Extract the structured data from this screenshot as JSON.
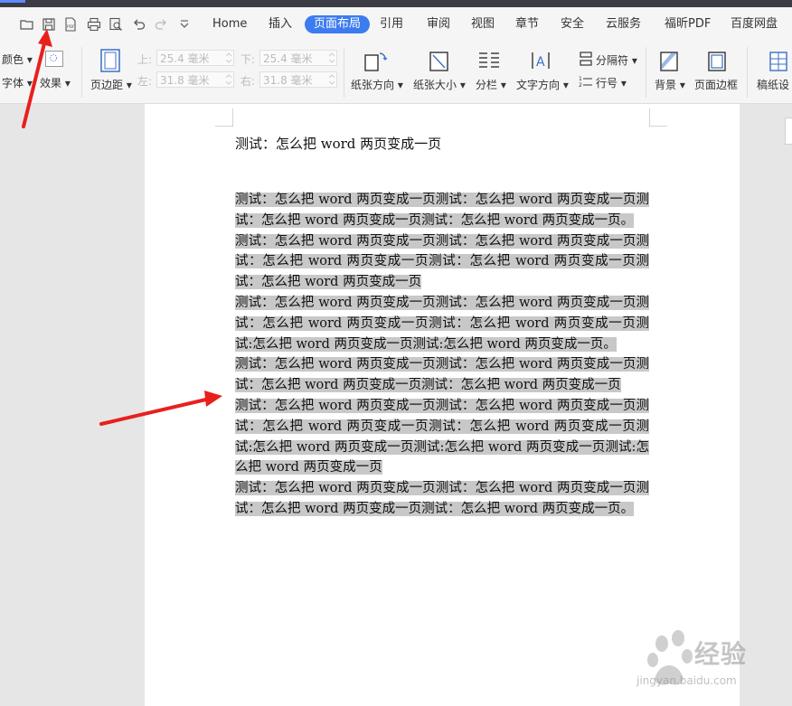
{
  "menubar": {
    "tabs": [
      "Home",
      "插入",
      "页面布局",
      "引用",
      "审阅",
      "视图",
      "章节",
      "安全",
      "云服务",
      "福昕PDF",
      "百度网盘"
    ],
    "active_tab": "页面布局",
    "accent_color": "#3d7cf0"
  },
  "quick_access": [
    "open-icon",
    "save-icon",
    "pdf-icon",
    "print-icon",
    "print-preview-icon",
    "undo-icon",
    "redo-icon",
    "customize-dropdown-icon"
  ],
  "ribbon": {
    "color_label": "颜色",
    "font_label": "字体",
    "effect_label": "效果",
    "margin_label": "页边距",
    "top_label": "上:",
    "top_value": "25.4 毫米",
    "bottom_label": "下:",
    "bottom_value": "25.4 毫米",
    "left_label": "左:",
    "left_value": "31.8 毫米",
    "right_label": "右:",
    "right_value": "31.8 毫米",
    "orientation_label": "纸张方向",
    "paper_size_label": "纸张大小",
    "columns_label": "分栏",
    "text_direction_label": "文字方向",
    "separator_label": "分隔符",
    "line_number_label": "行号",
    "background_label": "背景",
    "page_border_label": "页面边框",
    "draft_label": "稿纸设"
  },
  "document": {
    "title": "测试：怎么把 word 两页变成一页",
    "paragraphs": [
      "测试：怎么把 word 两页变成一页测试：怎么把 word 两页变成一页测试：怎么把 word 两页变成一页测试：怎么把 word 两页变成一页。",
      "测试：怎么把 word 两页变成一页测试：怎么把 word 两页变成一页测试：怎么把 word 两页变成一页测试：怎么把 word 两页变成一页测试：怎么把 word 两页变成一页",
      "测试：怎么把 word 两页变成一页测试：怎么把 word 两页变成一页测试：怎么把 word 两页变成一页测试：怎么把 word 两页变成一页测试:怎么把 word 两页变成一页测试:怎么把 word 两页变成一页。",
      "测试：怎么把 word 两页变成一页测试：怎么把 word 两页变成一页测试：怎么把 word 两页变成一页测试：怎么把 word 两页变成一页",
      "测试：怎么把 word 两页变成一页测试：怎么把 word 两页变成一页测试：怎么把 word 两页变成一页测试：怎么把 word 两页变成一页测试:怎么把 word 两页变成一页测试:怎么把 word 两页变成一页测试:怎么把 word 两页变成一页",
      "测试：怎么把 word 两页变成一页测试：怎么把 word 两页变成一页测试：怎么把 word 两页变成一页测试：怎么把 word 两页变成一页。"
    ],
    "highlight_color": "#c8c8c8"
  },
  "watermark": {
    "brand": "经验",
    "url": "jingyan.baidu.com"
  },
  "annotation_color": "#e8201c"
}
